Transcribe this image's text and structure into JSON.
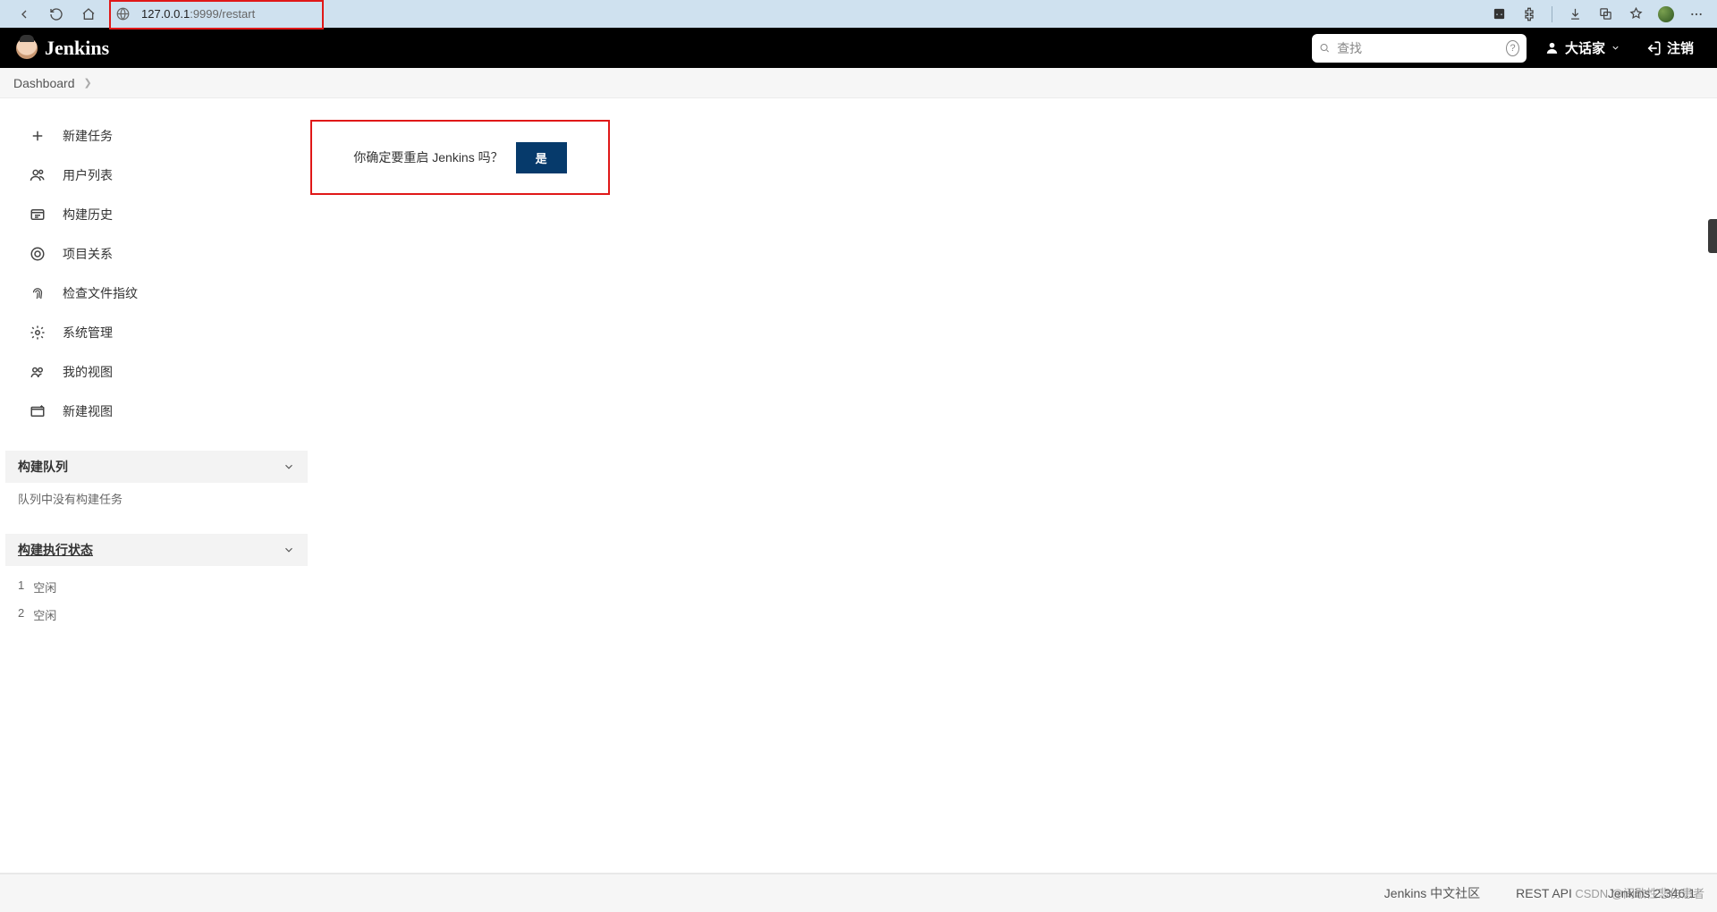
{
  "browser": {
    "url_prefix": "127.0.0.1",
    "url_suffix": ":9999/restart"
  },
  "header": {
    "logo_text": "Jenkins",
    "search_placeholder": "查找",
    "user_name": "大话家",
    "logout": "注销"
  },
  "breadcrumb": {
    "items": [
      "Dashboard"
    ]
  },
  "sidebar": {
    "items": [
      {
        "label": "新建任务",
        "icon": "plus"
      },
      {
        "label": "用户列表",
        "icon": "people"
      },
      {
        "label": "构建历史",
        "icon": "history"
      },
      {
        "label": "项目关系",
        "icon": "relation"
      },
      {
        "label": "检查文件指纹",
        "icon": "fingerprint"
      },
      {
        "label": "系统管理",
        "icon": "gear"
      },
      {
        "label": "我的视图",
        "icon": "eye"
      },
      {
        "label": "新建视图",
        "icon": "folder-plus"
      }
    ],
    "queue_title": "构建队列",
    "queue_empty": "队列中没有构建任务",
    "executor_title": "构建执行状态",
    "executors": [
      {
        "id": "1",
        "state": "空闲"
      },
      {
        "id": "2",
        "state": "空闲"
      }
    ]
  },
  "main": {
    "confirm_text": "你确定要重启 Jenkins 吗？",
    "yes_label": "是"
  },
  "footer": {
    "community": "Jenkins 中文社区",
    "rest_api": "REST API",
    "version": "Jenkins 2.346.1"
  },
  "watermark": "CSDN @间歇性悲伤患者"
}
